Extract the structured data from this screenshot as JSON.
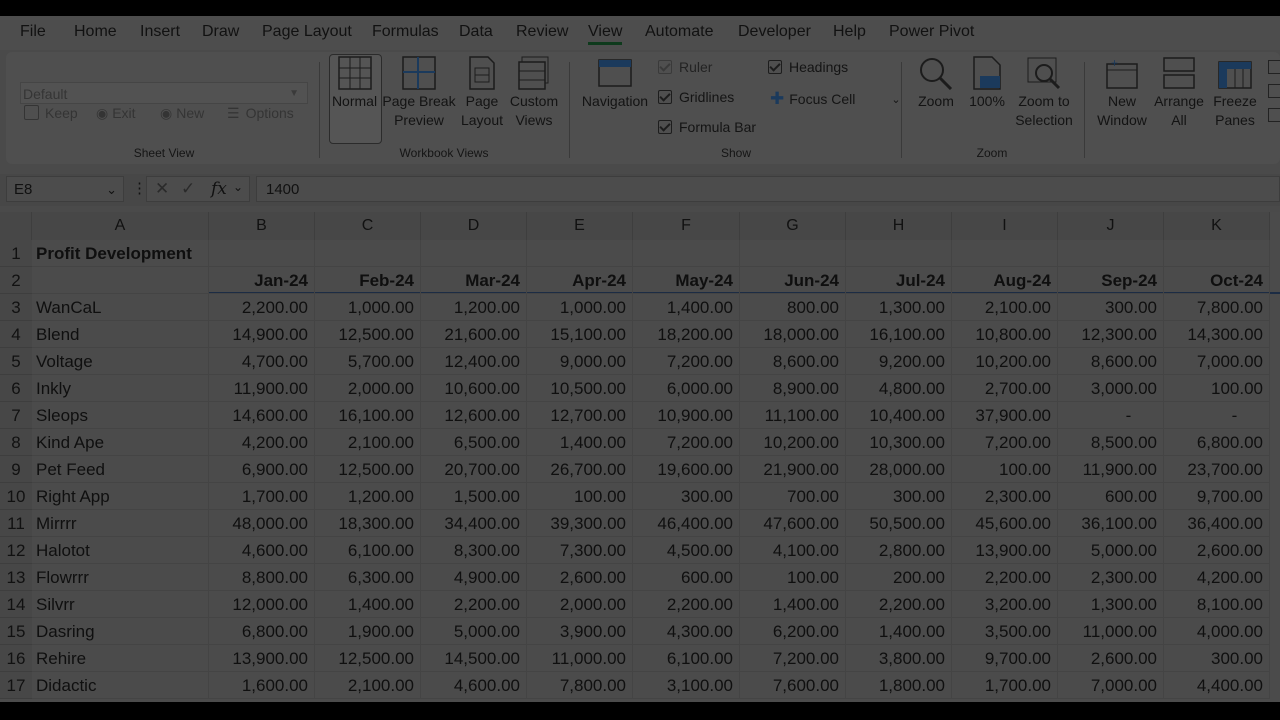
{
  "menu": [
    "File",
    "Home",
    "Insert",
    "Draw",
    "Page Layout",
    "Formulas",
    "Data",
    "Review",
    "View",
    "Automate",
    "Developer",
    "Help",
    "Power Pivot"
  ],
  "active_menu": "View",
  "ribbon": {
    "sheet_view": {
      "label": "Sheet View",
      "default_value": "Default",
      "keep": "Keep",
      "exit": "Exit",
      "new": "New",
      "options": "Options"
    },
    "workbook_views": {
      "label": "Workbook Views",
      "normal": "Normal",
      "page_break_1": "Page Break",
      "page_break_2": "Preview",
      "page_layout_1": "Page",
      "page_layout_2": "Layout",
      "custom_1": "Custom",
      "custom_2": "Views"
    },
    "show": {
      "label": "Show",
      "navigation": "Navigation",
      "ruler": "Ruler",
      "gridlines": "Gridlines",
      "formula_bar": "Formula Bar",
      "headings": "Headings",
      "focus_cell": "Focus Cell"
    },
    "zoom": {
      "label": "Zoom",
      "zoom": "Zoom",
      "hundred": "100%",
      "zoom_sel_1": "Zoom to",
      "zoom_sel_2": "Selection"
    },
    "window": {
      "new_window_1": "New",
      "new_window_2": "Window",
      "arrange_1": "Arrange",
      "arrange_2": "All",
      "freeze_1": "Freeze",
      "freeze_2": "Panes"
    }
  },
  "formula_bar": {
    "name_box": "E8",
    "formula": "1400"
  },
  "columns": [
    "A",
    "B",
    "C",
    "D",
    "E",
    "F",
    "G",
    "H",
    "I",
    "J",
    "K"
  ],
  "rows": [
    "1",
    "2",
    "3",
    "4",
    "5",
    "6",
    "7",
    "8",
    "9",
    "10",
    "11",
    "12",
    "13",
    "14",
    "15",
    "16",
    "17"
  ],
  "sheet": {
    "title": "Profit Development",
    "months": [
      "Jan-24",
      "Feb-24",
      "Mar-24",
      "Apr-24",
      "May-24",
      "Jun-24",
      "Jul-24",
      "Aug-24",
      "Sep-24",
      "Oct-24"
    ],
    "data": [
      [
        "WanCaL",
        "2,200.00",
        "1,000.00",
        "1,200.00",
        "1,000.00",
        "1,400.00",
        "800.00",
        "1,300.00",
        "2,100.00",
        "300.00",
        "7,800.00"
      ],
      [
        "Blend",
        "14,900.00",
        "12,500.00",
        "21,600.00",
        "15,100.00",
        "18,200.00",
        "18,000.00",
        "16,100.00",
        "10,800.00",
        "12,300.00",
        "14,300.00"
      ],
      [
        "Voltage",
        "4,700.00",
        "5,700.00",
        "12,400.00",
        "9,000.00",
        "7,200.00",
        "8,600.00",
        "9,200.00",
        "10,200.00",
        "8,600.00",
        "7,000.00"
      ],
      [
        "Inkly",
        "11,900.00",
        "2,000.00",
        "10,600.00",
        "10,500.00",
        "6,000.00",
        "8,900.00",
        "4,800.00",
        "2,700.00",
        "3,000.00",
        "100.00"
      ],
      [
        "Sleops",
        "14,600.00",
        "16,100.00",
        "12,600.00",
        "12,700.00",
        "10,900.00",
        "11,100.00",
        "10,400.00",
        "37,900.00",
        "-",
        "-"
      ],
      [
        "Kind Ape",
        "4,200.00",
        "2,100.00",
        "6,500.00",
        "1,400.00",
        "7,200.00",
        "10,200.00",
        "10,300.00",
        "7,200.00",
        "8,500.00",
        "6,800.00"
      ],
      [
        "Pet Feed",
        "6,900.00",
        "12,500.00",
        "20,700.00",
        "26,700.00",
        "19,600.00",
        "21,900.00",
        "28,000.00",
        "100.00",
        "11,900.00",
        "23,700.00"
      ],
      [
        "Right App",
        "1,700.00",
        "1,200.00",
        "1,500.00",
        "100.00",
        "300.00",
        "700.00",
        "300.00",
        "2,300.00",
        "600.00",
        "9,700.00"
      ],
      [
        "Mirrrr",
        "48,000.00",
        "18,300.00",
        "34,400.00",
        "39,300.00",
        "46,400.00",
        "47,600.00",
        "50,500.00",
        "45,600.00",
        "36,100.00",
        "36,400.00"
      ],
      [
        "Halotot",
        "4,600.00",
        "6,100.00",
        "8,300.00",
        "7,300.00",
        "4,500.00",
        "4,100.00",
        "2,800.00",
        "13,900.00",
        "5,000.00",
        "2,600.00"
      ],
      [
        "Flowrrr",
        "8,800.00",
        "6,300.00",
        "4,900.00",
        "2,600.00",
        "600.00",
        "100.00",
        "200.00",
        "2,200.00",
        "2,300.00",
        "4,200.00"
      ],
      [
        "Silvrr",
        "12,000.00",
        "1,400.00",
        "2,200.00",
        "2,000.00",
        "2,200.00",
        "1,400.00",
        "2,200.00",
        "3,200.00",
        "1,300.00",
        "8,100.00"
      ],
      [
        "Dasring",
        "6,800.00",
        "1,900.00",
        "5,000.00",
        "3,900.00",
        "4,300.00",
        "6,200.00",
        "1,400.00",
        "3,500.00",
        "11,000.00",
        "4,000.00"
      ],
      [
        "Rehire",
        "13,900.00",
        "12,500.00",
        "14,500.00",
        "11,000.00",
        "6,100.00",
        "7,200.00",
        "3,800.00",
        "9,700.00",
        "2,600.00",
        "300.00"
      ],
      [
        "Didactic",
        "1,600.00",
        "2,100.00",
        "4,600.00",
        "7,800.00",
        "3,100.00",
        "7,600.00",
        "1,800.00",
        "1,700.00",
        "7,000.00",
        "4,400.00"
      ]
    ]
  }
}
